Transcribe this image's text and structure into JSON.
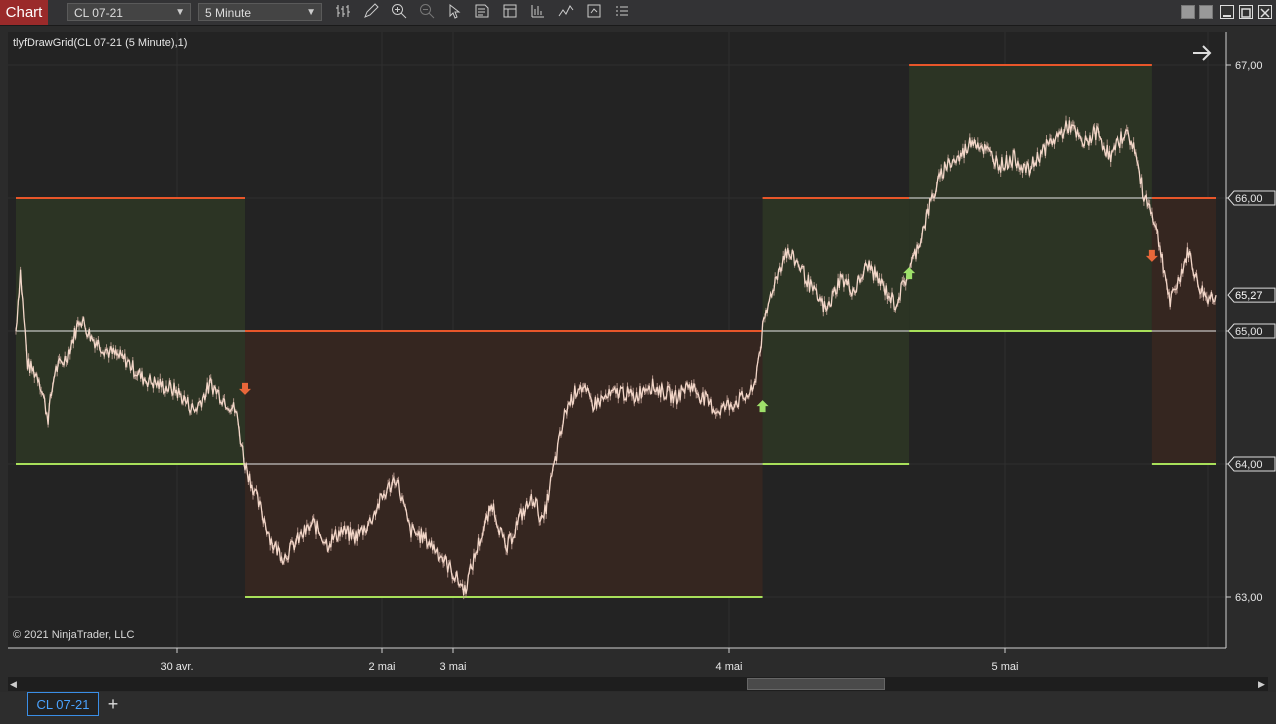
{
  "toolbar": {
    "chart_label": "Chart",
    "instrument": "CL 07-21",
    "interval": "5 Minute",
    "icons": [
      "bar-type-icon",
      "pencil-icon",
      "zoom-in-icon",
      "zoom-out-icon",
      "pointer-icon",
      "data-box-icon",
      "properties-icon",
      "indicators-icon",
      "strategies-icon",
      "templates-icon",
      "menu-icon"
    ]
  },
  "indicator_label": "tlyfDrawGrid(CL 07-21 (5 Minute),1)",
  "copyright": "© 2021 NinjaTrader, LLC",
  "tab": {
    "label": "CL 07-21",
    "add_label": "+"
  },
  "colors": {
    "background": "#232323",
    "bull_zone": "#2c3424",
    "bear_zone": "#352620",
    "upper_line": "#e8562a",
    "lower_line": "#a8e05a",
    "mid_line": "#e8e8e8",
    "price": "#f2d6c8"
  },
  "chart_data": {
    "type": "line",
    "title": "",
    "ylim": [
      62.75,
      67.25
    ],
    "y_ticks": [
      {
        "value": 63.0,
        "label": "63,00"
      },
      {
        "value": 64.0,
        "label": "64,00"
      },
      {
        "value": 65.0,
        "label": "65,00"
      },
      {
        "value": 66.0,
        "label": "66,00"
      },
      {
        "value": 67.0,
        "label": "67,00"
      }
    ],
    "last_price": {
      "value": 65.27,
      "label": "65,27"
    },
    "x_ticks": [
      "30 avr.",
      "2 mai",
      "3 mai",
      "4 mai",
      "5 mai"
    ],
    "price_path": [
      {
        "i": 0,
        "p": 65.0
      },
      {
        "i": 2,
        "p": 65.45
      },
      {
        "i": 5,
        "p": 64.75
      },
      {
        "i": 10,
        "p": 64.65
      },
      {
        "i": 14,
        "p": 64.35
      },
      {
        "i": 17,
        "p": 64.7
      },
      {
        "i": 22,
        "p": 64.8
      },
      {
        "i": 28,
        "p": 65.1
      },
      {
        "i": 33,
        "p": 64.95
      },
      {
        "i": 40,
        "p": 64.85
      },
      {
        "i": 48,
        "p": 64.78
      },
      {
        "i": 55,
        "p": 64.65
      },
      {
        "i": 62,
        "p": 64.6
      },
      {
        "i": 70,
        "p": 64.55
      },
      {
        "i": 78,
        "p": 64.4
      },
      {
        "i": 85,
        "p": 64.6
      },
      {
        "i": 90,
        "p": 64.5
      },
      {
        "i": 96,
        "p": 64.4
      },
      {
        "i": 100,
        "p": 64.0
      },
      {
        "i": 106,
        "p": 63.7
      },
      {
        "i": 112,
        "p": 63.4
      },
      {
        "i": 117,
        "p": 63.3
      },
      {
        "i": 124,
        "p": 63.45
      },
      {
        "i": 130,
        "p": 63.55
      },
      {
        "i": 136,
        "p": 63.4
      },
      {
        "i": 142,
        "p": 63.5
      },
      {
        "i": 148,
        "p": 63.45
      },
      {
        "i": 154,
        "p": 63.55
      },
      {
        "i": 160,
        "p": 63.75
      },
      {
        "i": 166,
        "p": 63.9
      },
      {
        "i": 172,
        "p": 63.5
      },
      {
        "i": 178,
        "p": 63.45
      },
      {
        "i": 184,
        "p": 63.35
      },
      {
        "i": 190,
        "p": 63.2
      },
      {
        "i": 196,
        "p": 63.05
      },
      {
        "i": 202,
        "p": 63.4
      },
      {
        "i": 208,
        "p": 63.7
      },
      {
        "i": 214,
        "p": 63.35
      },
      {
        "i": 220,
        "p": 63.6
      },
      {
        "i": 226,
        "p": 63.75
      },
      {
        "i": 230,
        "p": 63.55
      },
      {
        "i": 234,
        "p": 63.9
      },
      {
        "i": 240,
        "p": 64.4
      },
      {
        "i": 246,
        "p": 64.6
      },
      {
        "i": 252,
        "p": 64.45
      },
      {
        "i": 258,
        "p": 64.5
      },
      {
        "i": 264,
        "p": 64.55
      },
      {
        "i": 270,
        "p": 64.5
      },
      {
        "i": 276,
        "p": 64.6
      },
      {
        "i": 282,
        "p": 64.55
      },
      {
        "i": 288,
        "p": 64.5
      },
      {
        "i": 294,
        "p": 64.6
      },
      {
        "i": 300,
        "p": 64.5
      },
      {
        "i": 306,
        "p": 64.4
      },
      {
        "i": 312,
        "p": 64.45
      },
      {
        "i": 318,
        "p": 64.5
      },
      {
        "i": 322,
        "p": 64.55
      },
      {
        "i": 326,
        "p": 65.0
      },
      {
        "i": 330,
        "p": 65.3
      },
      {
        "i": 336,
        "p": 65.6
      },
      {
        "i": 342,
        "p": 65.5
      },
      {
        "i": 348,
        "p": 65.3
      },
      {
        "i": 354,
        "p": 65.15
      },
      {
        "i": 360,
        "p": 65.4
      },
      {
        "i": 366,
        "p": 65.3
      },
      {
        "i": 372,
        "p": 65.5
      },
      {
        "i": 378,
        "p": 65.35
      },
      {
        "i": 384,
        "p": 65.2
      },
      {
        "i": 390,
        "p": 65.45
      },
      {
        "i": 395,
        "p": 65.7
      },
      {
        "i": 400,
        "p": 66.0
      },
      {
        "i": 406,
        "p": 66.25
      },
      {
        "i": 412,
        "p": 66.3
      },
      {
        "i": 418,
        "p": 66.45
      },
      {
        "i": 424,
        "p": 66.35
      },
      {
        "i": 430,
        "p": 66.25
      },
      {
        "i": 436,
        "p": 66.3
      },
      {
        "i": 442,
        "p": 66.2
      },
      {
        "i": 448,
        "p": 66.35
      },
      {
        "i": 454,
        "p": 66.45
      },
      {
        "i": 460,
        "p": 66.55
      },
      {
        "i": 466,
        "p": 66.4
      },
      {
        "i": 472,
        "p": 66.5
      },
      {
        "i": 478,
        "p": 66.3
      },
      {
        "i": 484,
        "p": 66.5
      },
      {
        "i": 488,
        "p": 66.4
      },
      {
        "i": 492,
        "p": 66.05
      },
      {
        "i": 496,
        "p": 65.9
      },
      {
        "i": 500,
        "p": 65.6
      },
      {
        "i": 504,
        "p": 65.2
      },
      {
        "i": 508,
        "p": 65.4
      },
      {
        "i": 512,
        "p": 65.6
      },
      {
        "i": 516,
        "p": 65.35
      },
      {
        "i": 520,
        "p": 65.25
      },
      {
        "i": 524,
        "p": 65.27
      }
    ],
    "zones": [
      {
        "kind": "bull",
        "start": 0,
        "end": 100,
        "upper": 66.0,
        "lower": 64.0
      },
      {
        "kind": "bear",
        "start": 100,
        "end": 326,
        "upper": 65.0,
        "lower": 63.0
      },
      {
        "kind": "bull",
        "start": 326,
        "end": 390,
        "upper": 66.0,
        "lower": 64.0
      },
      {
        "kind": "bull",
        "start": 390,
        "end": 496,
        "upper": 67.0,
        "lower": 65.0
      },
      {
        "kind": "bear",
        "start": 496,
        "end": 524,
        "upper": 66.0,
        "lower": 64.0
      }
    ],
    "signals": [
      {
        "dir": "down",
        "i": 100,
        "p": 64.55
      },
      {
        "dir": "up",
        "i": 326,
        "p": 64.45
      },
      {
        "dir": "up",
        "i": 390,
        "p": 65.45
      },
      {
        "dir": "down",
        "i": 496,
        "p": 65.55
      }
    ]
  }
}
